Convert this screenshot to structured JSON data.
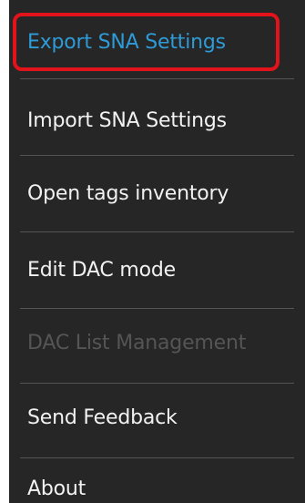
{
  "menu": {
    "items": [
      {
        "label": "Export SNA Settings",
        "state": "highlighted"
      },
      {
        "label": "Import SNA Settings",
        "state": "enabled"
      },
      {
        "label": "Open tags inventory",
        "state": "enabled"
      },
      {
        "label": "Edit DAC mode",
        "state": "enabled"
      },
      {
        "label": "DAC List Management",
        "state": "disabled"
      },
      {
        "label": "Send Feedback",
        "state": "enabled"
      },
      {
        "label": "About",
        "state": "enabled"
      }
    ]
  },
  "colors": {
    "background": "#262626",
    "text": "#f2f2f2",
    "active_text": "#2e9bd6",
    "disabled_text": "#555555",
    "highlight_border": "#e3131b",
    "separator": "#555555"
  }
}
